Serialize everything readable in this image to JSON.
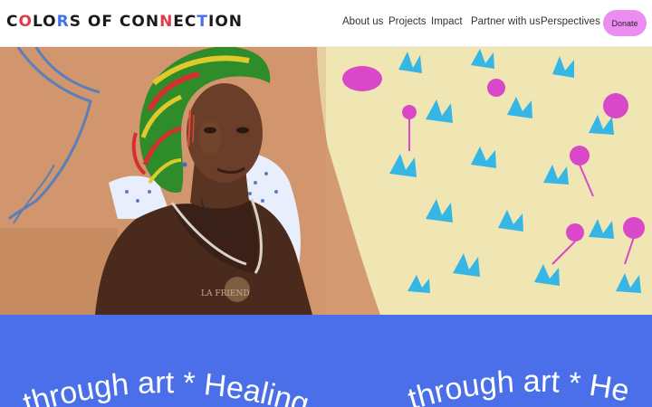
{
  "header": {
    "logo_text": "COLORS OF CONNECTION",
    "nav": [
      "About us",
      "Projects",
      "Impact",
      "Partner with us",
      "Perspectives"
    ],
    "donate_label": "Donate"
  },
  "hero": {
    "image_icon": "mural-portrait-photo",
    "shirt_text": "LA FRIEND"
  },
  "banner": {
    "tagline_left": "through art  *  Healing",
    "tagline_right": "through art  *  He"
  },
  "colors": {
    "accent_pink": "#ec8df2",
    "banner_blue": "#4a6fe9",
    "mural_tan": "#d49a72",
    "mural_cream": "#efe6b4",
    "leaf_blue": "#35b6e4",
    "flower_magenta": "#d848c8"
  }
}
